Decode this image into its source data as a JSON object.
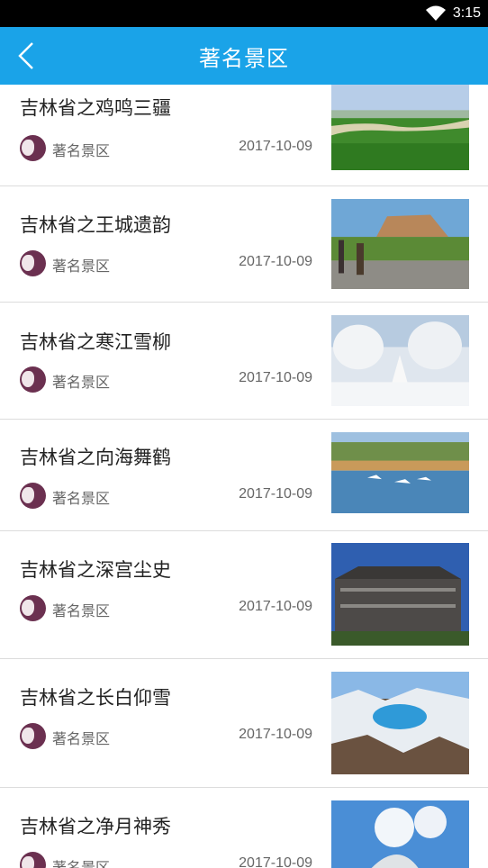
{
  "status": {
    "time": "3:15"
  },
  "header": {
    "title": "著名景区"
  },
  "items": [
    {
      "title": "吉林省之鸡鸣三疆",
      "source": "著名景区",
      "date": "2017-10-09"
    },
    {
      "title": "吉林省之王城遗韵",
      "source": "著名景区",
      "date": "2017-10-09"
    },
    {
      "title": "吉林省之寒江雪柳",
      "source": "著名景区",
      "date": "2017-10-09"
    },
    {
      "title": "吉林省之向海舞鹤",
      "source": "著名景区",
      "date": "2017-10-09"
    },
    {
      "title": "吉林省之深宫尘史",
      "source": "著名景区",
      "date": "2017-10-09"
    },
    {
      "title": "吉林省之长白仰雪",
      "source": "著名景区",
      "date": "2017-10-09"
    },
    {
      "title": "吉林省之净月神秀",
      "source": "著名景区",
      "date": "2017-10-09"
    }
  ],
  "colors": {
    "accent": "#1aa3e8",
    "statusbar": "#000000"
  },
  "icons": {
    "back": "chevron-left-icon",
    "wifi": "wifi-icon"
  }
}
